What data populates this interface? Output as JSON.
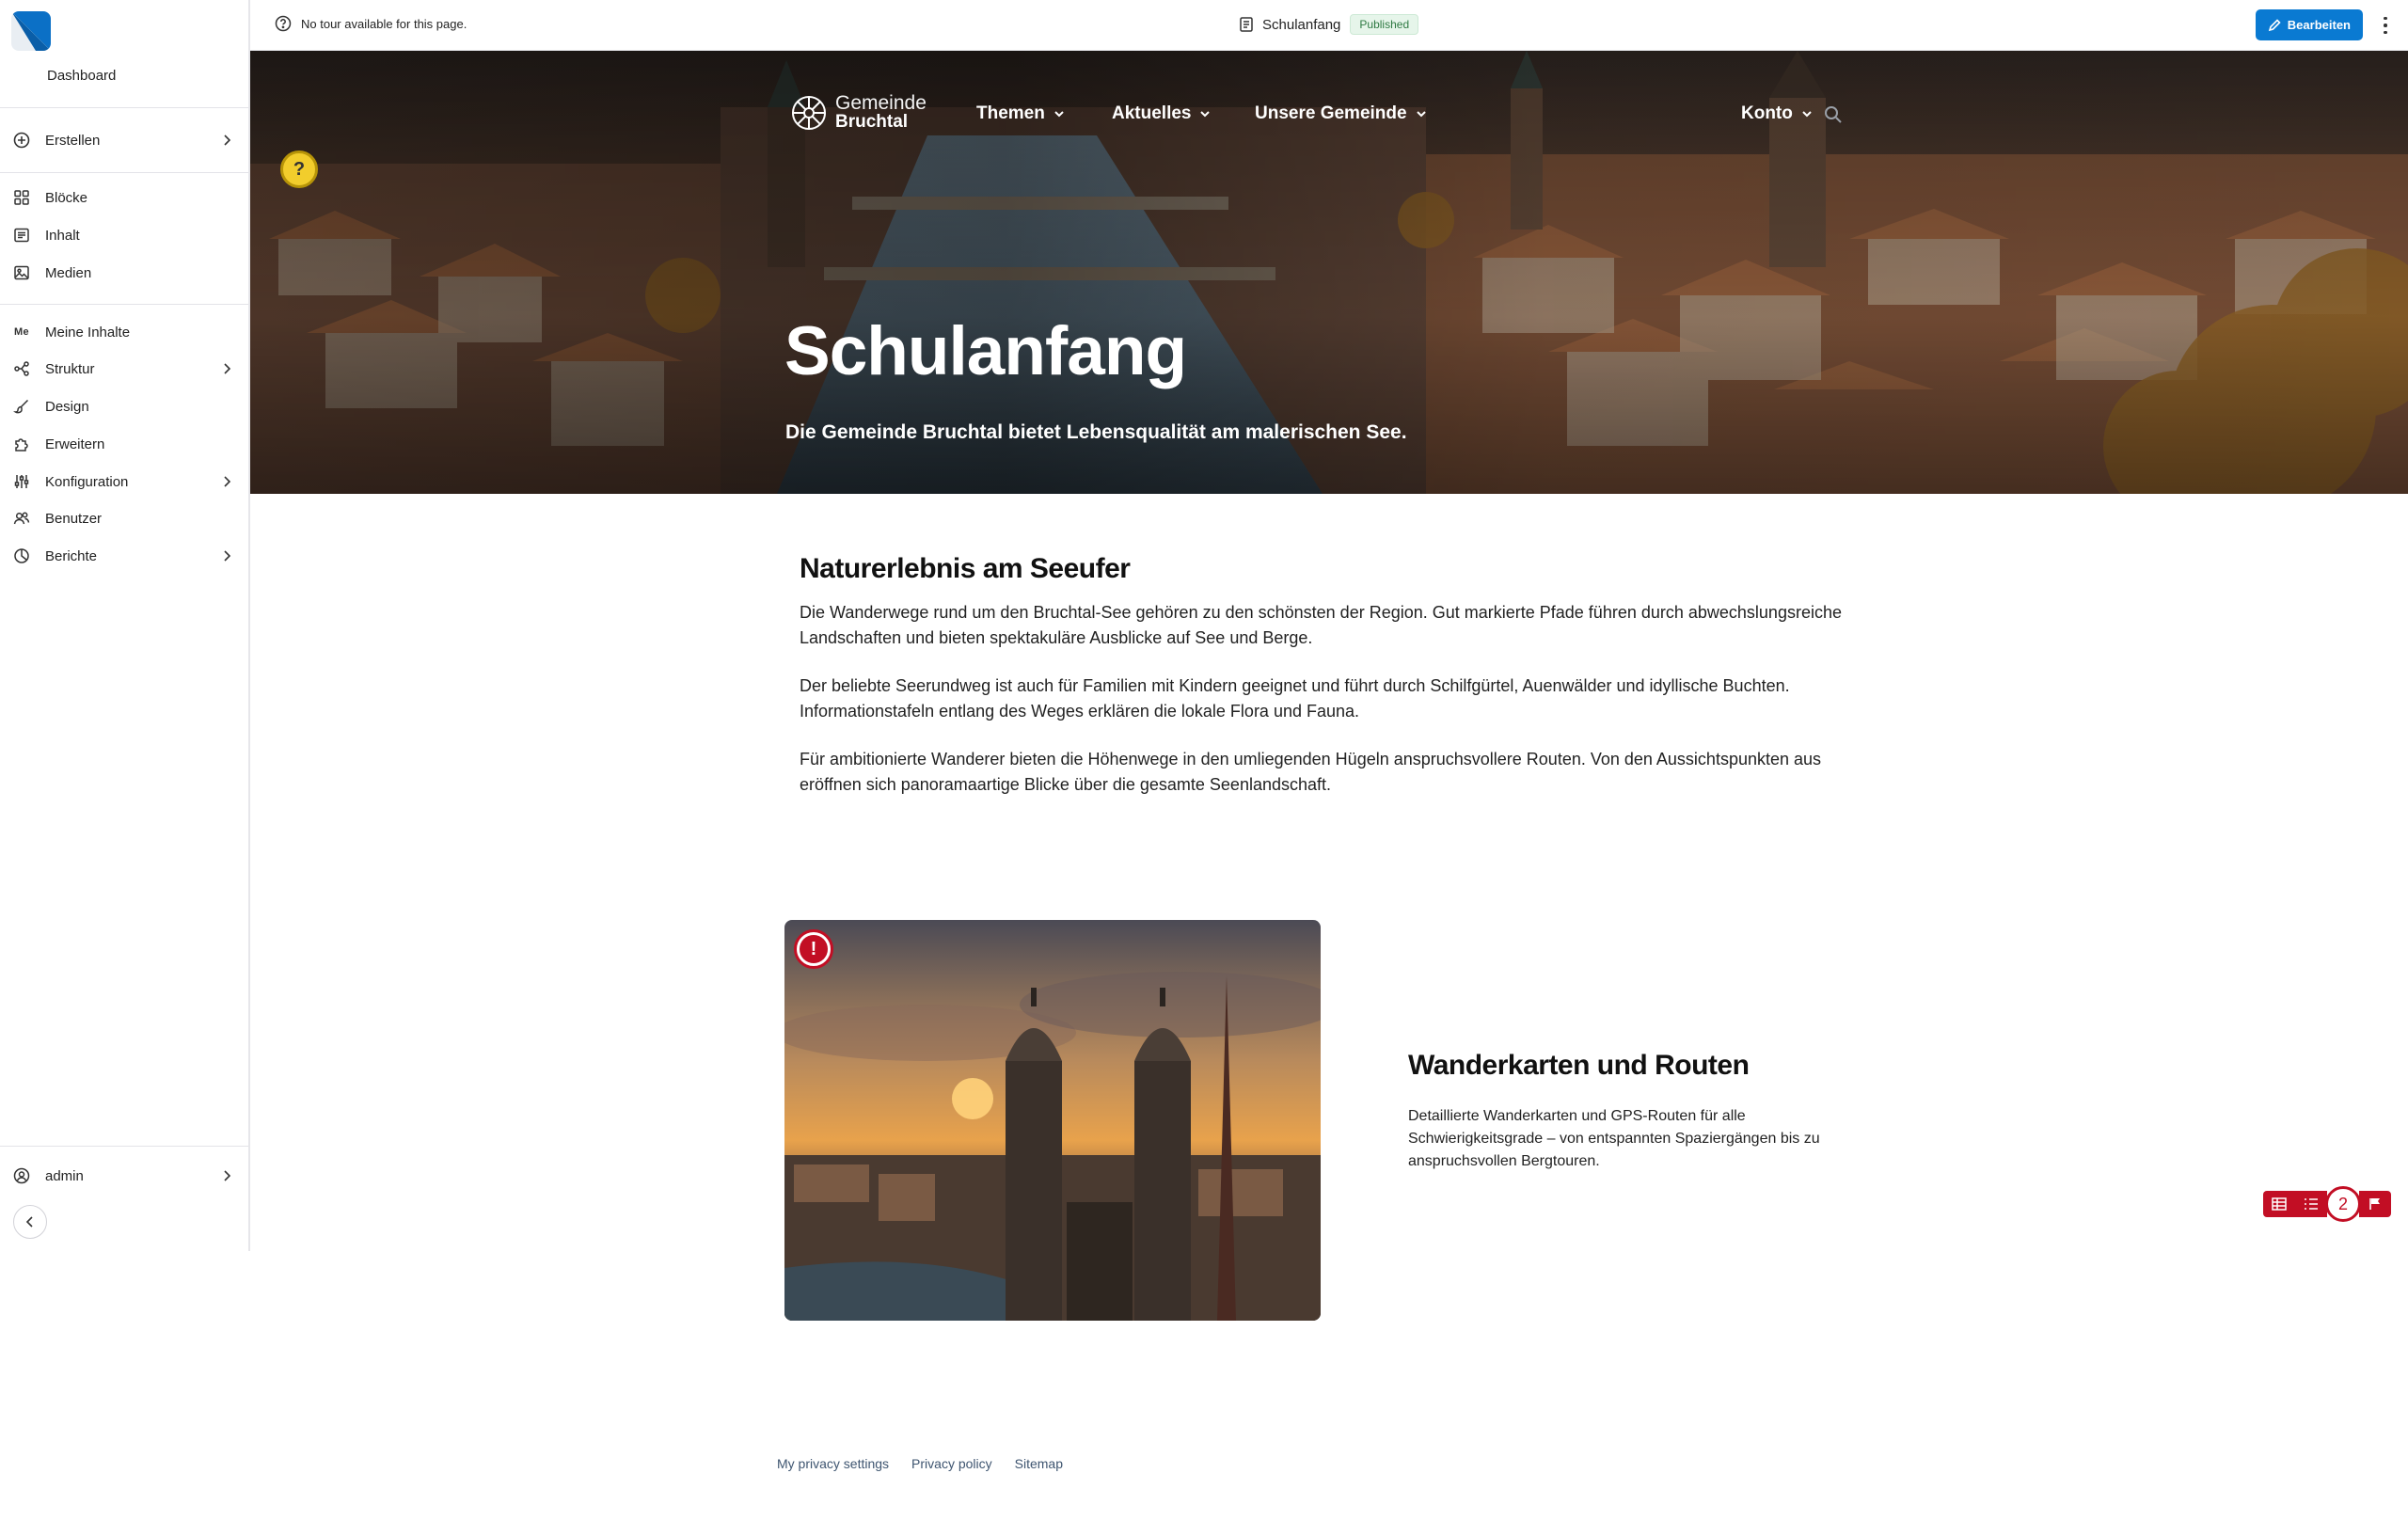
{
  "sidebar": {
    "dashboard": "Dashboard",
    "items": [
      {
        "label": "Erstellen"
      },
      {
        "label": "Blöcke"
      },
      {
        "label": "Inhalt"
      },
      {
        "label": "Medien"
      },
      {
        "label": "Meine Inhalte",
        "icon_text": "Me"
      },
      {
        "label": "Struktur"
      },
      {
        "label": "Design"
      },
      {
        "label": "Erweitern"
      },
      {
        "label": "Konfiguration"
      },
      {
        "label": "Benutzer"
      },
      {
        "label": "Berichte"
      }
    ],
    "user": "admin"
  },
  "topbar": {
    "tour_text": "No tour available for this page.",
    "page_title": "Schulanfang",
    "status_badge": "Published",
    "edit_label": "Bearbeiten"
  },
  "site": {
    "brand_line1": "Gemeinde",
    "brand_line2": "Bruchtal",
    "nav": [
      {
        "label": "Themen"
      },
      {
        "label": "Aktuelles"
      },
      {
        "label": "Unsere Gemeinde"
      },
      {
        "label": "Konto"
      }
    ],
    "help_marker": "?"
  },
  "hero": {
    "title": "Schulanfang",
    "subtitle": "Die Gemeinde Bruchtal bietet Lebensqualität am malerischen See."
  },
  "content": {
    "heading": "Naturerlebnis am Seeufer",
    "paragraphs": [
      "Die Wanderwege rund um den Bruchtal-See gehören zu den schönsten der Region. Gut markierte Pfade führen durch abwechslungsreiche Landschaften und bieten spektakuläre Ausblicke auf See und Berge.",
      "Der beliebte Seerundweg ist auch für Familien mit Kindern geeignet und führt durch Schilfgürtel, Auenwälder und idyllische Buchten. Informationstafeln entlang des Weges erklären die lokale Flora und Fauna.",
      "Für ambitionierte Wanderer bieten die Höhenwege in den umliegenden Hügeln anspruchsvollere Routen. Von den Aussichtspunkten aus eröffnen sich panoramaartige Blicke über die gesamte Seenlandschaft."
    ]
  },
  "card": {
    "alert_marker": "!",
    "title": "Wanderkarten und Routen",
    "text": "Detaillierte Wanderkarten und GPS-Routen für alle Schwierigkeitsgrade – von entspannten Spaziergängen bis zu anspruchsvollen Bergtouren."
  },
  "a11y_toolbar": {
    "issue_count": "2"
  },
  "footer": {
    "links": [
      "My privacy settings",
      "Privacy policy",
      "Sitemap"
    ]
  },
  "colors": {
    "primary": "#0a7ad2",
    "alert": "#c20e24",
    "help": "#f2cd2c",
    "published_bg": "#e6f5ea"
  }
}
